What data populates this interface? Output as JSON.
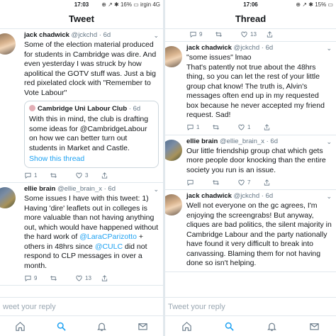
{
  "left": {
    "status": {
      "left": "",
      "time": "17:03",
      "right": "⊕ ↗ ✱ 16% ▭ irgin 4G"
    },
    "title": "Tweet",
    "tweets": [
      {
        "name": "jack chadwick",
        "handle": "@jckchd",
        "time": "· 6d",
        "text": "Some of the election material produced for students in Cambridge was dire. And even yesterday I was struck by how apolitical the GOTV stuff was. Just a big red pixelated clock with \"Remember to Vote Labour\"",
        "quote": {
          "name": "Cambridge Uni Labour Club",
          "time": "· 6d",
          "text": "With this in mind, the club is drafting some ideas for @CambridgeLabour on how we can better turn out students in Market and Castle.",
          "show": "Show this thread"
        },
        "counts": {
          "reply": "1",
          "retweet": "",
          "like": "3"
        }
      },
      {
        "name": "ellie brain",
        "handle": "@ellie_brain_x",
        "time": "· 6d",
        "text_parts": {
          "a": "Some issues I have with this tweet: 1) Having 'dire' leaflets out in colleges is more valuable than not having anything out, which would have happened without the hard work of ",
          "link1": "@LaraCParizotto",
          "b": " + others in 48hrs since ",
          "link2": "@CULC",
          "c": " did not respond to CLP messages in over a month."
        },
        "counts": {
          "reply": "9",
          "retweet": "",
          "like": "13"
        }
      }
    ],
    "reply_placeholder": "weet your reply"
  },
  "right": {
    "status": {
      "time": "17:06",
      "right": "⊕ ↗ ✱ 15% ▭"
    },
    "title": "Thread",
    "top_counts": {
      "reply": "9",
      "retweet": "",
      "like": "13"
    },
    "tweets": [
      {
        "name": "jack chadwick",
        "handle": "@jckchd",
        "time": "· 6d",
        "text": "\"some issues\" lmao\nThat's patently not true about the 48hrs thing, so you can let the rest of your little group chat know! The truth is, Alvin's messages often end up in my requested box because he never accepted my friend request. Sad!",
        "counts": {
          "reply": "1",
          "retweet": "",
          "like": "1"
        }
      },
      {
        "name": "ellie brain",
        "handle": "@ellie_brain_x",
        "time": "· 6d",
        "text": "Our little friendship group chat which gets more people door knocking than the entire society you run is an issue.",
        "counts": {
          "reply": "",
          "retweet": "",
          "like": "7"
        }
      },
      {
        "name": "jack chadwick",
        "handle": "@jckchd",
        "time": "· 6d",
        "text": "Well not everyone on the gc agrees, I'm enjoying the screengrabs! But anyway, cliques are bad politics, the silent majority in Cambridge Labour and the party nationally have found it very difficult to break into canvassing. Blaming them for not having done so isn't helping.",
        "counts": {
          "reply": "",
          "retweet": "",
          "like": ""
        }
      }
    ],
    "reply_placeholder": "Tweet your reply"
  },
  "icons": [
    "reply-icon",
    "retweet-icon",
    "like-icon",
    "share-icon",
    "home-icon",
    "search-icon",
    "notifications-icon",
    "messages-icon",
    "chevron-down-icon"
  ],
  "colors": {
    "link": "#1da1f2",
    "muted": "#657786",
    "divider": "#e1e8ed"
  }
}
